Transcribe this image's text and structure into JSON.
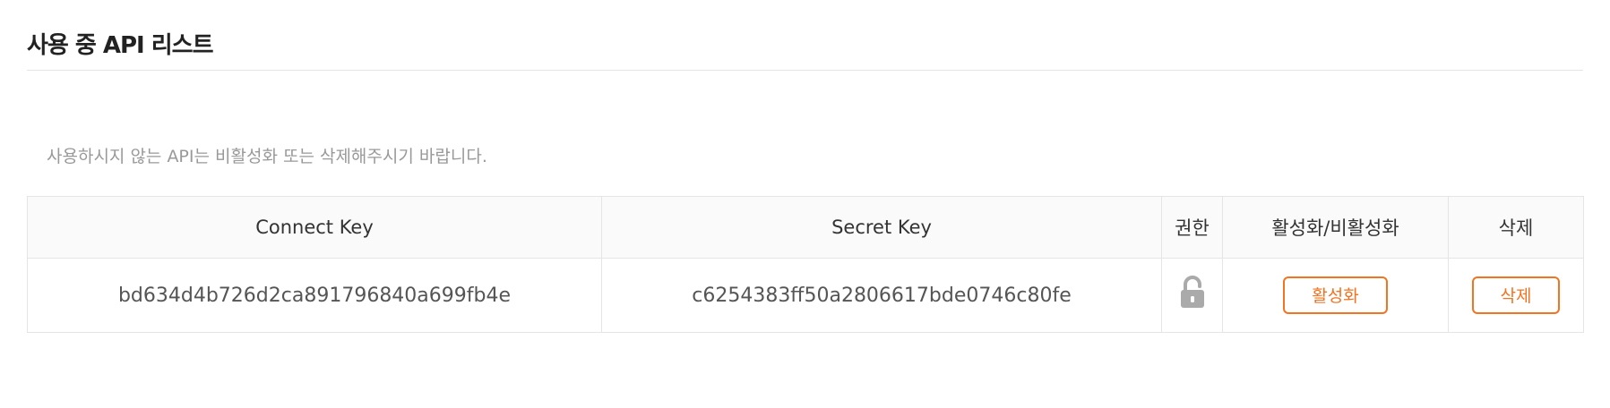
{
  "section": {
    "title": "사용 중 API 리스트",
    "notice": "사용하시지 않는 API는 비활성화 또는 삭제해주시기 바랍니다."
  },
  "table": {
    "headers": {
      "connect_key": "Connect Key",
      "secret_key": "Secret Key",
      "permission": "권한",
      "toggle": "활성화/비활성화",
      "delete": "삭제"
    },
    "rows": [
      {
        "connect_key": "bd634d4b726d2ca891796840a699fb4e",
        "secret_key": "c6254383ff50a2806617bde0746c80fe",
        "permission_icon": "unlocked-padlock-icon",
        "activate_label": "활성화",
        "delete_label": "삭제"
      }
    ]
  },
  "colors": {
    "accent": "#f37321",
    "border": "#e5e5e5",
    "header_bg": "#fafafa",
    "notice_text": "#999999",
    "lock_icon": "#aaaaaa"
  }
}
